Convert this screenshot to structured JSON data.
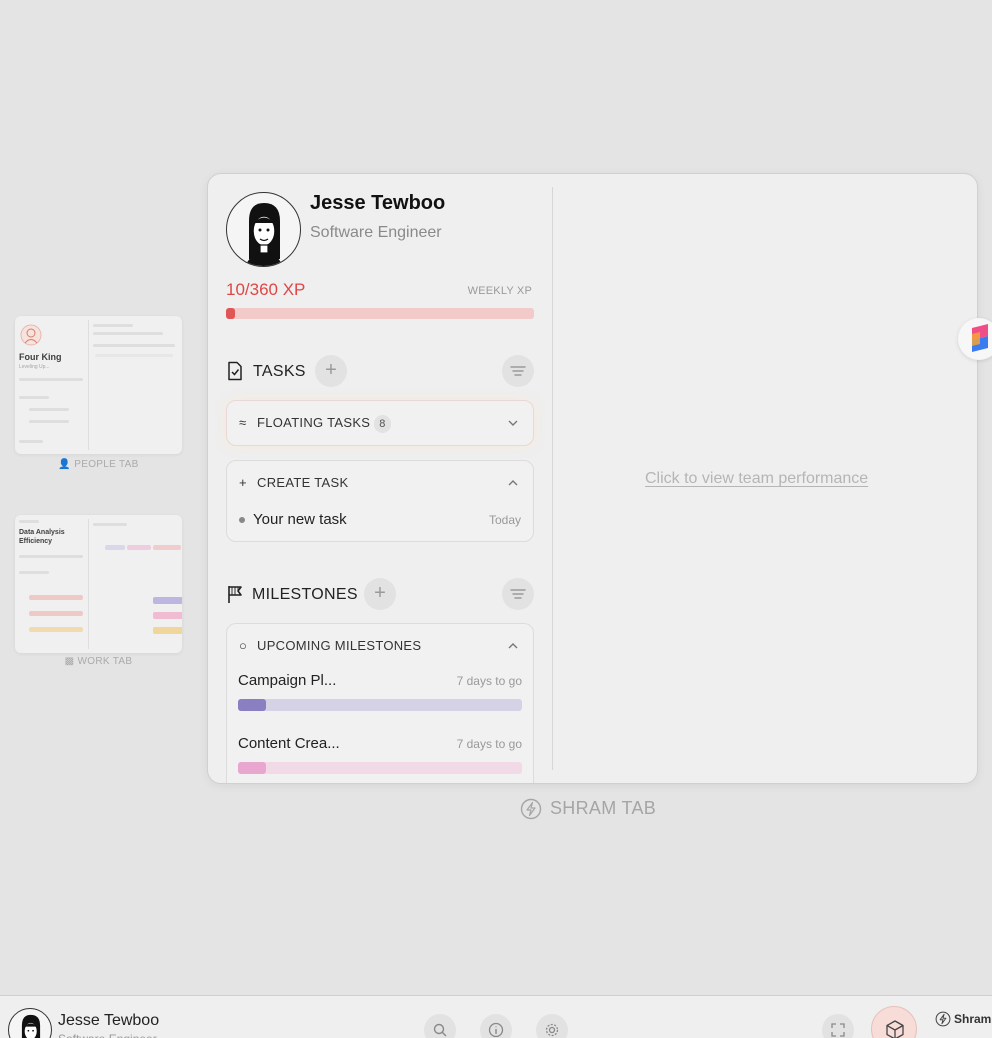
{
  "profile": {
    "name": "Jesse Tewboo",
    "role": "Software Engineer"
  },
  "xp": {
    "value_text": "10/360 XP",
    "label": "WEEKLY XP",
    "progress_fraction": 0.028
  },
  "tasks": {
    "title": "TASKS",
    "add_label": "+",
    "floating": {
      "label": "FLOATING TASKS",
      "count": "8"
    },
    "create": {
      "label": "CREATE TASK",
      "items": [
        {
          "name": "Your new task",
          "date": "Today"
        }
      ]
    }
  },
  "milestones": {
    "title": "MILESTONES",
    "add_label": "+",
    "upcoming_label": "UPCOMING MILESTONES",
    "items": [
      {
        "name": "Campaign Pl...",
        "due": "7 days to go",
        "progress_fraction": 0.1,
        "color": "#8a7fc0",
        "track_color": "#d6d2e6"
      },
      {
        "name": "Content Crea...",
        "due": "7 days to go",
        "progress_fraction": 0.1,
        "color": "#e9a6cf",
        "track_color": "#f1d9e6"
      }
    ]
  },
  "team_link": "Click to view team performance",
  "tabs": {
    "current": "SHRAM TAB",
    "people": "PEOPLE TAB",
    "work": "WORK TAB"
  },
  "thumbnails": {
    "people": {
      "title": "Four King",
      "subtitle": "Leveling Up..."
    },
    "work": {
      "title_line1": "Data Analysis",
      "title_line2": "Efficiency"
    }
  },
  "bottombar": {
    "name": "Jesse Tewboo",
    "role": "Software Engineer",
    "brand": "Shram"
  },
  "colors": {
    "accent_red": "#e04646",
    "xp_track": "#f3caca",
    "background": "#e4e4e4"
  }
}
